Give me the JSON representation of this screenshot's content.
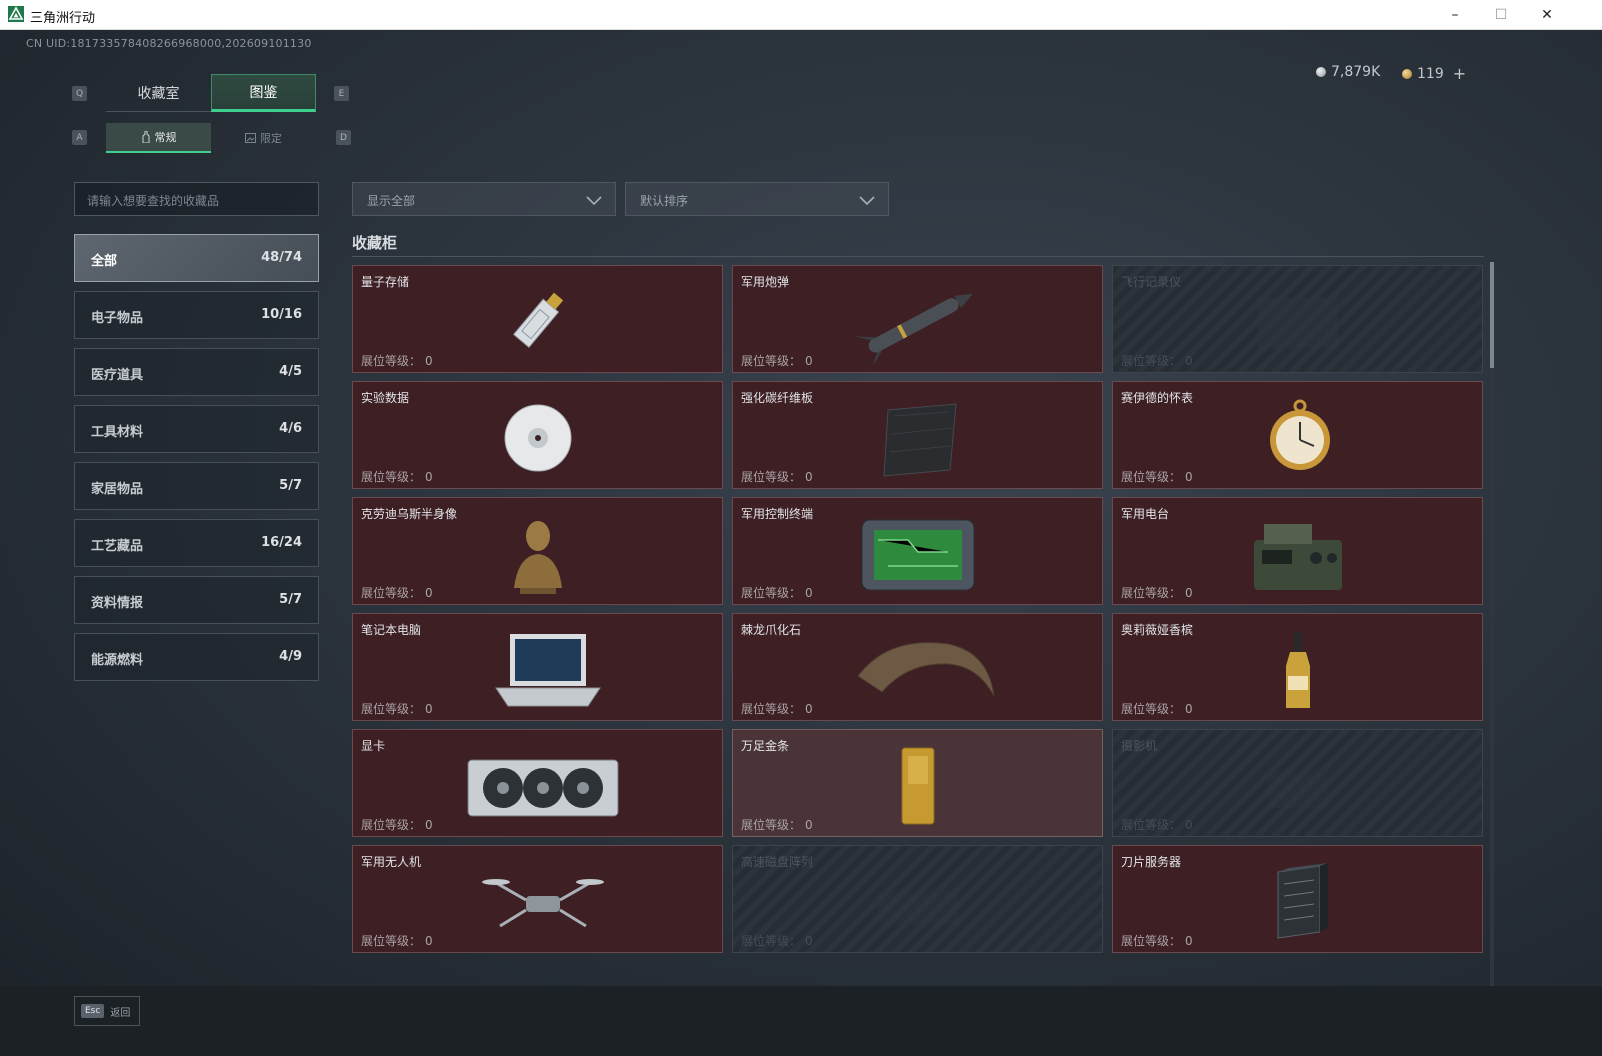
{
  "window": {
    "title": "三角洲行动",
    "minimize": "–",
    "maximize": "☐",
    "close": "✕"
  },
  "header": {
    "uid": "CN UID:181733578408266968000,202609101130",
    "currency": [
      {
        "icon": "silver-coin-icon",
        "value": "7,879K",
        "color": "#c8ccd0"
      },
      {
        "icon": "gold-coin-icon",
        "value": "119",
        "color": "#d9b46a",
        "plus": "+"
      }
    ]
  },
  "tabs": [
    {
      "label": "收藏室",
      "active": false
    },
    {
      "label": "图鉴",
      "active": true
    }
  ],
  "tab_keys": {
    "left": "Q",
    "right": "E"
  },
  "subtabs": [
    {
      "label": "常规",
      "icon": "bottle-icon",
      "active": true
    },
    {
      "label": "限定",
      "icon": "picture-icon",
      "active": false
    }
  ],
  "subtab_keys": {
    "left": "A",
    "right": "D"
  },
  "search": {
    "placeholder": "请输入想要查找的收藏品"
  },
  "filters": [
    {
      "value": "显示全部"
    },
    {
      "value": "默认排序"
    }
  ],
  "categories": [
    {
      "label": "全部",
      "count": "48/74",
      "active": true
    },
    {
      "label": "电子物品",
      "count": "10/16"
    },
    {
      "label": "医疗道具",
      "count": "4/5"
    },
    {
      "label": "工具材料",
      "count": "4/6"
    },
    {
      "label": "家居物品",
      "count": "5/7"
    },
    {
      "label": "工艺藏品",
      "count": "16/24"
    },
    {
      "label": "资料情报",
      "count": "5/7"
    },
    {
      "label": "能源燃料",
      "count": "4/9"
    }
  ],
  "section": {
    "title": "收藏柜"
  },
  "level_label": "展位等级：",
  "items": [
    {
      "name": "量子存储",
      "level": "0",
      "state": "owned",
      "icon": "usb-drive-icon"
    },
    {
      "name": "军用炮弹",
      "level": "0",
      "state": "owned",
      "icon": "missile-icon"
    },
    {
      "name": "飞行记录仪",
      "level": "0",
      "state": "locked",
      "icon": "flight-recorder-icon"
    },
    {
      "name": "实验数据",
      "level": "0",
      "state": "owned",
      "icon": "disc-icon"
    },
    {
      "name": "强化碳纤维板",
      "level": "0",
      "state": "owned",
      "icon": "carbon-plate-icon"
    },
    {
      "name": "赛伊德的怀表",
      "level": "0",
      "state": "owned",
      "icon": "pocket-watch-icon"
    },
    {
      "name": "克劳迪乌斯半身像",
      "level": "0",
      "state": "owned",
      "icon": "bust-icon"
    },
    {
      "name": "军用控制终端",
      "level": "0",
      "state": "owned",
      "icon": "control-terminal-icon"
    },
    {
      "name": "军用电台",
      "level": "0",
      "state": "owned",
      "icon": "radio-icon"
    },
    {
      "name": "笔记本电脑",
      "level": "0",
      "state": "owned",
      "icon": "laptop-icon"
    },
    {
      "name": "棘龙爪化石",
      "level": "0",
      "state": "owned",
      "icon": "claw-fossil-icon"
    },
    {
      "name": "奥莉薇娅香槟",
      "level": "0",
      "state": "owned",
      "icon": "champagne-icon"
    },
    {
      "name": "显卡",
      "level": "0",
      "state": "owned",
      "icon": "gpu-icon"
    },
    {
      "name": "万足金条",
      "level": "0",
      "state": "gold",
      "icon": "gold-bar-icon"
    },
    {
      "name": "摄影机",
      "level": "0",
      "state": "locked",
      "icon": "camera-icon"
    },
    {
      "name": "军用无人机",
      "level": "0",
      "state": "owned",
      "icon": "drone-icon"
    },
    {
      "name": "高速磁盘阵列",
      "level": "0",
      "state": "locked",
      "icon": "disk-array-icon"
    },
    {
      "name": "刀片服务器",
      "level": "0",
      "state": "owned",
      "icon": "blade-server-icon"
    }
  ],
  "footer": {
    "key": "Esc",
    "label": "返回"
  }
}
